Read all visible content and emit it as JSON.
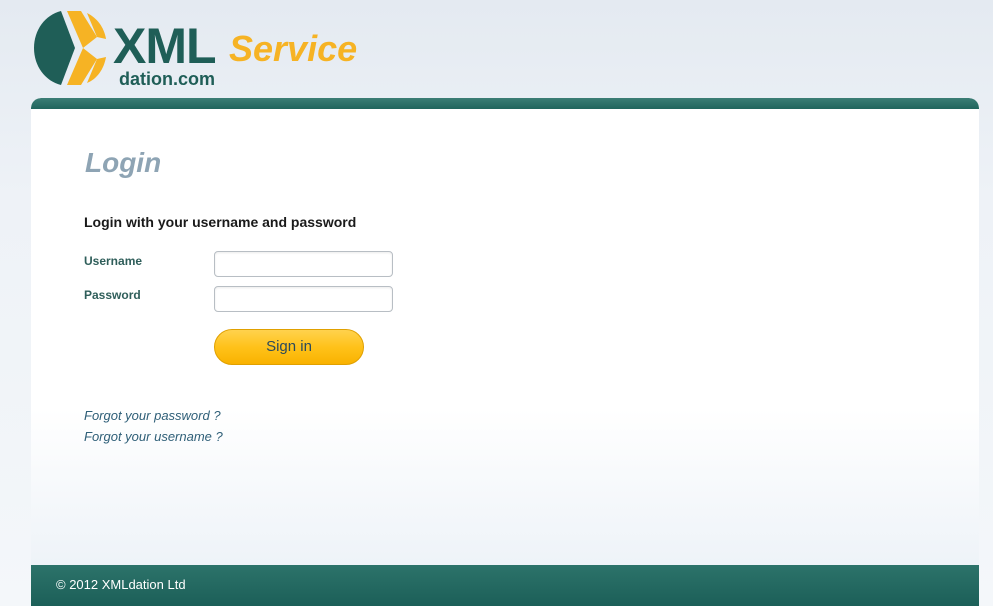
{
  "header": {
    "logo": {
      "text_xml": "XML",
      "text_service": "Service",
      "text_domain": "dation.com",
      "icon": "xmldation-x-logo-icon"
    }
  },
  "main": {
    "title": "Login",
    "subtitle": "Login with your username and password",
    "form": {
      "username_label": "Username",
      "username_value": "",
      "password_label": "Password",
      "password_value": "",
      "submit_label": "Sign in"
    },
    "links": {
      "forgot_password": "Forgot your password ?",
      "forgot_username": "Forgot your username ?"
    }
  },
  "footer": {
    "copyright": "© 2012 XMLdation Ltd"
  },
  "colors": {
    "brand_green": "#1f5e57",
    "brand_orange": "#f6b324",
    "title_gray": "#8ea4b4",
    "button_yellow": "#ffc21a",
    "link_blue": "#2f5f78"
  }
}
